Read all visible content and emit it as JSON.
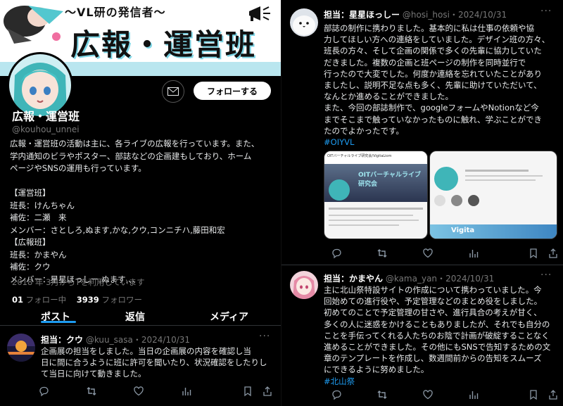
{
  "profile": {
    "banner_subtitle": "〜VL研の発信者〜",
    "banner_title": "広報・運営班",
    "name": "広報・運営班",
    "handle": "@kouhou_unnei",
    "follow_label": "フォローする",
    "bio_lines": [
      "広報・運営班の活動は主に、各ライブの広報を行っています。また、",
      "学内通知のビラやポスター、部誌などの企画建もしており、ホーム",
      "ページやSNSの運用も行っています。",
      "",
      "【運営班】",
      "班長：けんちゃん",
      "補佐：二瀬　来",
      "メンバー：さとしろ,ぬます,かな,クウ,コンニチハ,藤田和宏",
      "【広報班】",
      "班長：かまやん",
      "補佐：クウ",
      "メンバー：星星ほっしー,ぬます,、、"
    ],
    "joined": "2018 年 3月からTを利用しています",
    "following_count": "01",
    "following_label": "フォロー中",
    "followers_count": "3939",
    "followers_label": "フォロワー",
    "tabs": [
      "ポスト",
      "返信",
      "メディア"
    ]
  },
  "tweets_left": [
    {
      "name": "担当：クウ",
      "handle": "@kuu_sasa",
      "date": "2024/10/31",
      "more": "···",
      "lines": [
        "企画展の担当をしました。当日の企画展の内容を確認し当",
        "日に間に合うように班に許可を聞いたり、状況確認をしたりし",
        "て当日に向けて動きました。"
      ]
    }
  ],
  "tweets_right": [
    {
      "name": "担当：星星ほっしー",
      "handle": "@hosi_hosi",
      "date": "2024/10/31",
      "more": "···",
      "lines": [
        "部誌の制作に携わりました。基本的に私は仕事の依頼や協",
        "力してほしい方への連絡をしていました。デザイン班の方々、",
        "班長の方々、そして企画の関係で多くの先輩に協力していた",
        "だきました。複数の企画と班ページの制作を同時並行で",
        "行ったので大変でした。何度か連絡を忘れていたことがあり",
        "ましたし、説明不足な点も多く、先輩に助けていただいて、",
        "なんとか進めることができました。",
        "また、今回の部誌制作で、googleフォームやNotionなど今",
        "までそこまで触っていなかったものに触れ、学ぶことができ",
        "たのでよかったです。"
      ],
      "hashtag": "#OIYVL",
      "shot1_title": "OITバーチャルライブ研究会",
      "shot1_handle": "OITバーチャルライブ研究会/VigitaLiom",
      "shot2_banner": "Vigita"
    },
    {
      "name": "担当：かまやん",
      "handle": "@kama_yan",
      "date": "2024/10/31",
      "more": "···",
      "lines": [
        "主に北山祭特設サイトの作成について携わっていました。今",
        "回始めての進行役や、予定管理などのまとめ役をしました。",
        "初めてのことで予定管理の甘さや、進行具合の考えが甘く、",
        "多くの人に迷惑をかけることもありましたが、それでも自分の",
        "ことを手伝ってくれる人たちのお陰で計画が破綻することなく",
        "進めることができました。その他にもSNSで告知するための文",
        "章のテンプレートを作成し、数週間前からの告知をスムーズ",
        "にできるように努めました。"
      ],
      "hashtag": "#北山祭"
    }
  ],
  "colors": {
    "background": "#000000",
    "text": "#e7e9ea",
    "muted": "#777777",
    "accent": "#1d9bf0",
    "banner_stripe": "#b9e6ef"
  },
  "icons": [
    "envelope-icon",
    "reply-icon",
    "repost-icon",
    "like-icon",
    "views-icon",
    "bookmark-icon",
    "share-icon",
    "megaphone-icon"
  ]
}
